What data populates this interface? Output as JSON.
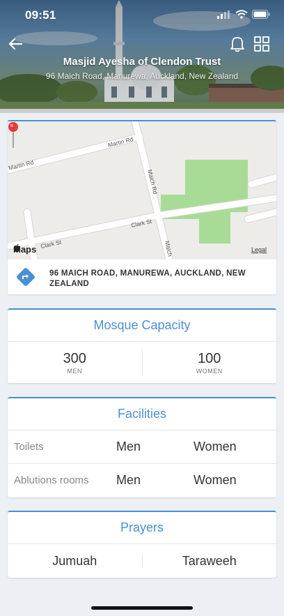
{
  "status_bar": {
    "time": "09:51"
  },
  "header": {
    "title": "Masjid Ayesha of Clendon Trust",
    "subtitle": "96 Maich Road, Manurewa, Auckland, New Zealand",
    "back_icon": "arrow-left-icon",
    "bell_icon": "bell-icon",
    "grid_icon": "grid-icon"
  },
  "map": {
    "street_labels": [
      "Martin Rd",
      "Martin Rd",
      "Maich Rd",
      "Clark St",
      "Clark St",
      "Maich"
    ],
    "provider": "Maps",
    "legal": "Legal",
    "address": "96 MAICH ROAD, MANUREWA, AUCKLAND, NEW ZEALAND"
  },
  "capacity": {
    "title": "Mosque Capacity",
    "men_count": "300",
    "men_label": "MEN",
    "women_count": "100",
    "women_label": "WOMEN"
  },
  "facilities": {
    "title": "Facilities",
    "rows": [
      {
        "label": "Toilets",
        "men": "Men",
        "women": "Women"
      },
      {
        "label": "Ablutions rooms",
        "men": "Men",
        "women": "Women"
      }
    ]
  },
  "prayers": {
    "title": "Prayers",
    "items": [
      "Jumuah",
      "Taraweeh"
    ]
  },
  "colors": {
    "accent": "#4a8fd4",
    "park": "#a8dc96",
    "map_bg": "#eeece8"
  }
}
